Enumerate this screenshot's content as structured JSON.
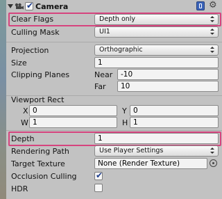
{
  "header": {
    "title": "Camera",
    "enabled": true
  },
  "clear_flags": {
    "label": "Clear Flags",
    "value": "Depth only"
  },
  "culling_mask": {
    "label": "Culling Mask",
    "value": "UI1"
  },
  "projection": {
    "label": "Projection",
    "value": "Orthographic"
  },
  "size": {
    "label": "Size",
    "value": "1"
  },
  "clipping_planes": {
    "label": "Clipping Planes",
    "near_label": "Near",
    "near_value": "-10",
    "far_label": "Far",
    "far_value": "10"
  },
  "viewport_rect": {
    "label": "Viewport Rect",
    "x_label": "X",
    "x_value": "0",
    "y_label": "Y",
    "y_value": "0",
    "w_label": "W",
    "w_value": "1",
    "h_label": "H",
    "h_value": "1"
  },
  "depth": {
    "label": "Depth",
    "value": "1"
  },
  "rendering_path": {
    "label": "Rendering Path",
    "value": "Use Player Settings"
  },
  "target_texture": {
    "label": "Target Texture",
    "value": "None (Render Texture)"
  },
  "occlusion_culling": {
    "label": "Occlusion Culling",
    "checked": true
  },
  "hdr": {
    "label": "HDR",
    "checked": false
  },
  "colors": {
    "highlight": "#d6447e",
    "check": "#1c3c8c"
  }
}
